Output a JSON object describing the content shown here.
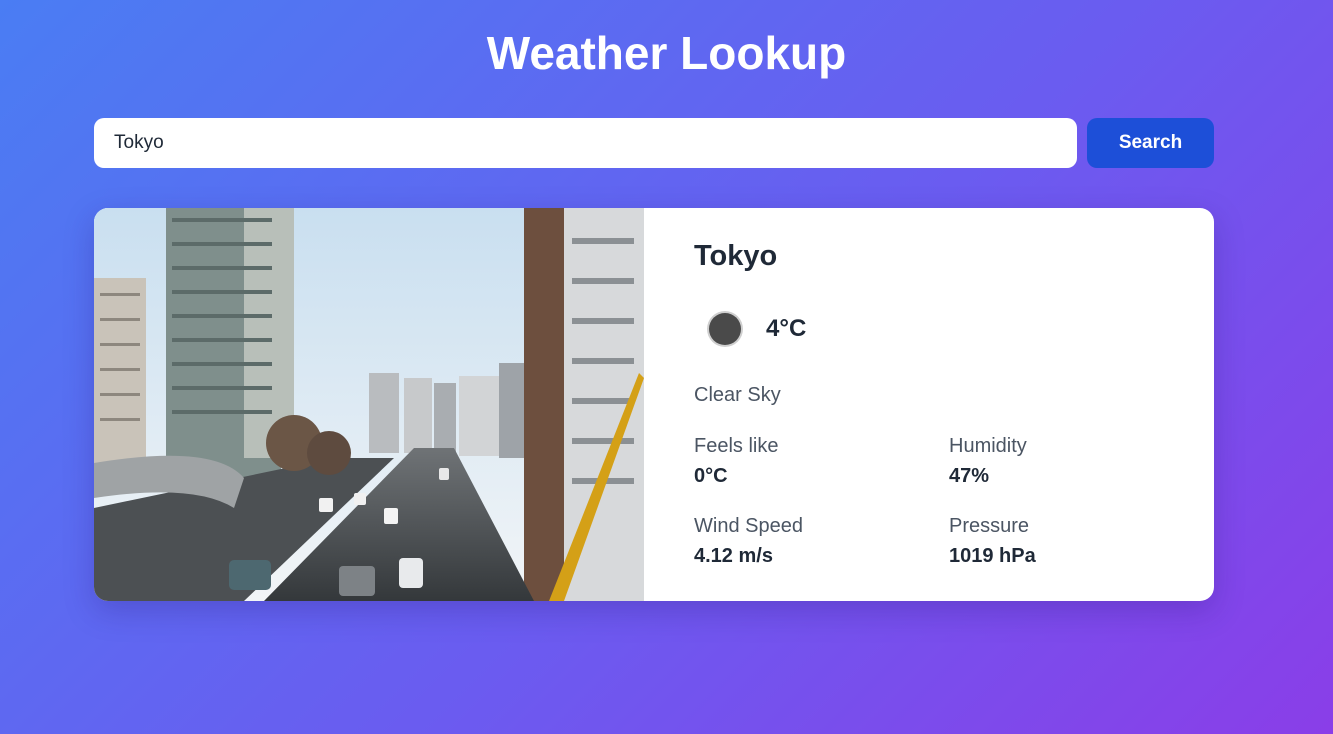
{
  "page": {
    "title": "Weather Lookup"
  },
  "search": {
    "value": "Tokyo",
    "button_label": "Search"
  },
  "weather": {
    "city": "Tokyo",
    "icon": "weather-condition-icon",
    "temperature": "4°C",
    "description": "Clear Sky",
    "stats": {
      "feels_like": {
        "label": "Feels like",
        "value": "0°C"
      },
      "humidity": {
        "label": "Humidity",
        "value": "47%"
      },
      "wind_speed": {
        "label": "Wind Speed",
        "value": "4.12 m/s"
      },
      "pressure": {
        "label": "Pressure",
        "value": "1019 hPa"
      }
    }
  },
  "colors": {
    "background_start": "#4a7df3",
    "background_end": "#8a3ee8",
    "button": "#1d4fd8",
    "card": "#ffffff"
  }
}
